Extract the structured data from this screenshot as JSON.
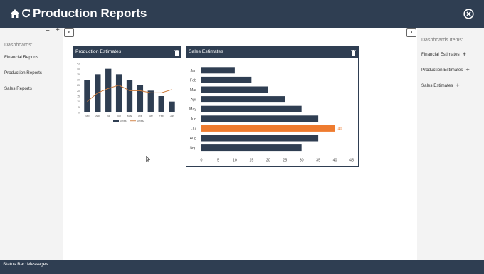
{
  "header": {
    "title": "Production Reports",
    "icons": [
      "home-icon",
      "refresh-icon",
      "close-circle-icon"
    ]
  },
  "left_panel": {
    "zoom_minus": "−",
    "zoom_plus": "+",
    "heading": "Dashboards:",
    "items": [
      "Financial Reports",
      "Production Reports",
      "Sales Reports"
    ]
  },
  "right_panel": {
    "heading": "Dashboards Items:",
    "items": [
      "Financial Estimates",
      "Production Estimates",
      "Sales Estimates"
    ]
  },
  "widgets": {
    "production": {
      "title": "Production Estimates"
    },
    "sales": {
      "title": "Sales Estimates"
    }
  },
  "status_bar": {
    "text": "Status Bar: Messages"
  },
  "colors": {
    "navy": "#2f3e52",
    "highlight": "#ee7b2f",
    "line": "#cc7a3a"
  },
  "chart_data": [
    {
      "type": "bar",
      "title": "Production Estimates",
      "categories": [
        "Sep",
        "Aug",
        "Jul",
        "Jun",
        "May",
        "Apr",
        "Mar",
        "Feb",
        "Jan"
      ],
      "series": [
        {
          "name": "Series1",
          "type": "bar",
          "values": [
            30,
            35,
            40,
            35,
            30,
            25,
            20,
            15,
            10
          ]
        },
        {
          "name": "Series2",
          "type": "line",
          "values": [
            10,
            18,
            22,
            25,
            20,
            20,
            18,
            18,
            21
          ]
        }
      ],
      "ylim": [
        0,
        45
      ],
      "yticks": [
        0,
        5,
        10,
        15,
        20,
        25,
        30,
        35,
        40,
        45
      ],
      "legend": "bottom"
    },
    {
      "type": "bar",
      "orientation": "horizontal",
      "title": "Sales Estimates",
      "categories": [
        "Jan",
        "Feb",
        "Mar",
        "Apr",
        "May",
        "Jun",
        "Jul",
        "Aug",
        "Sep"
      ],
      "values": [
        10,
        15,
        20,
        25,
        30,
        35,
        40,
        35,
        30
      ],
      "highlight": {
        "category": "Jul",
        "label": "40"
      },
      "xlim": [
        0,
        45
      ],
      "xticks": [
        0,
        5,
        10,
        15,
        20,
        25,
        30,
        35,
        40,
        45
      ]
    }
  ]
}
